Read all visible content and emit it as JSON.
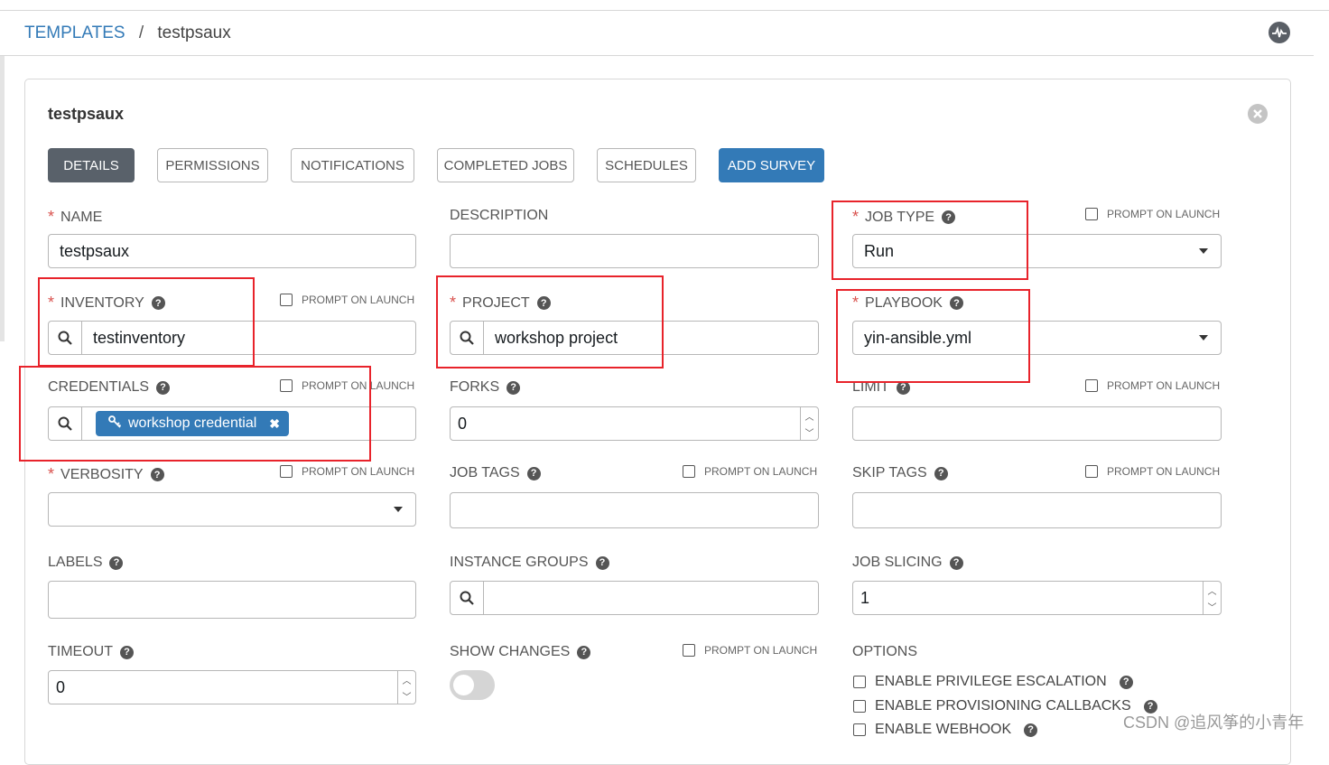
{
  "breadcrumb": {
    "root": "TEMPLATES",
    "current": "testpsaux"
  },
  "panel": {
    "title": "testpsaux"
  },
  "tabs": [
    "DETAILS",
    "PERMISSIONS",
    "NOTIFICATIONS",
    "COMPLETED JOBS",
    "SCHEDULES",
    "ADD SURVEY"
  ],
  "prompt_on_launch": "PROMPT ON LAUNCH",
  "fields": {
    "name": {
      "label": "NAME",
      "value": "testpsaux"
    },
    "description": {
      "label": "DESCRIPTION",
      "value": ""
    },
    "job_type": {
      "label": "JOB TYPE",
      "value": "Run"
    },
    "inventory": {
      "label": "INVENTORY",
      "value": "testinventory"
    },
    "project": {
      "label": "PROJECT",
      "value": "workshop project"
    },
    "playbook": {
      "label": "PLAYBOOK",
      "value": "yin-ansible.yml"
    },
    "credentials": {
      "label": "CREDENTIALS",
      "chip": "workshop credential"
    },
    "forks": {
      "label": "FORKS",
      "value": "0"
    },
    "limit": {
      "label": "LIMIT",
      "value": ""
    },
    "verbosity": {
      "label": "VERBOSITY",
      "value": ""
    },
    "job_tags": {
      "label": "JOB TAGS",
      "value": ""
    },
    "skip_tags": {
      "label": "SKIP TAGS",
      "value": ""
    },
    "labels": {
      "label": "LABELS",
      "value": ""
    },
    "instance_groups": {
      "label": "INSTANCE GROUPS",
      "value": ""
    },
    "job_slicing": {
      "label": "JOB SLICING",
      "value": "1"
    },
    "timeout": {
      "label": "TIMEOUT",
      "value": "0"
    },
    "show_changes": {
      "label": "SHOW CHANGES",
      "enabled": false
    }
  },
  "options": {
    "label": "OPTIONS",
    "items": [
      "ENABLE PRIVILEGE ESCALATION",
      "ENABLE PROVISIONING CALLBACKS",
      "ENABLE WEBHOOK"
    ]
  },
  "watermark": "CSDN @追风筝的小青年",
  "colors": {
    "accent": "#337ab7",
    "active_tab": "#59616a",
    "required": "#d9534f",
    "highlight": "#e8232b"
  },
  "icons": [
    "activity-stream-icon",
    "close-icon",
    "help-icon",
    "search-icon",
    "key-icon",
    "remove-chip-icon",
    "caret-down-icon",
    "spinner-arrows-icon",
    "checkbox-icon"
  ]
}
